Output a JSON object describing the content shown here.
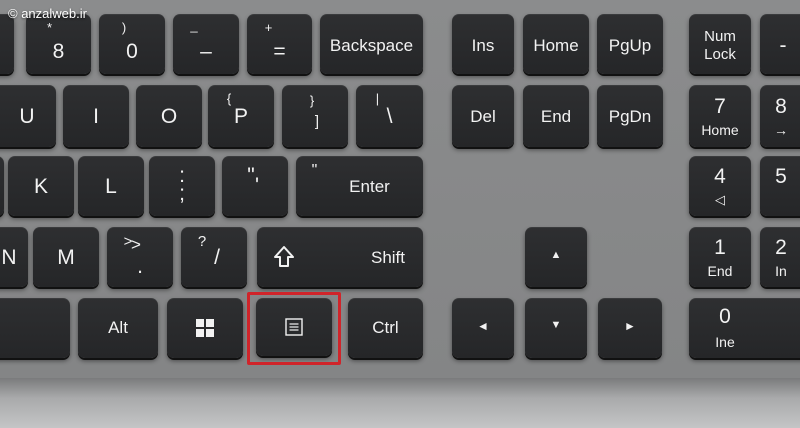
{
  "watermark": "© anzalweb.ir",
  "keys": {
    "eight": {
      "top": "*",
      "main": "8"
    },
    "zero": {
      "top": ")",
      "main": "0"
    },
    "minus": {
      "top": "_",
      "main": "–"
    },
    "equals": {
      "top": "+",
      "main": "="
    },
    "backspace": "Backspace",
    "ins": "Ins",
    "home": "Home",
    "pgup": "PgUp",
    "numlock": {
      "line1": "Num",
      "line2": "Lock"
    },
    "num_minus": "-",
    "u": "U",
    "i": "I",
    "o": "O",
    "p": "P",
    "lbracket": {
      "top": "{",
      "main": "["
    },
    "rbracket": {
      "top": "}",
      "main": "]"
    },
    "backslash": {
      "top": "|",
      "main": "\\"
    },
    "del": "Del",
    "end": "End",
    "pgdn": "PgDn",
    "num7": {
      "main": "7",
      "sub": "Home"
    },
    "num8": {
      "main": "8",
      "sub": "→"
    },
    "k": "K",
    "l": "L",
    "semicolon": {
      "top": ":",
      "main": ";"
    },
    "quote": {
      "top": "\"",
      "main": "'"
    },
    "enter": {
      "top": "\"",
      "main": "Enter"
    },
    "num4": {
      "main": "4",
      "sub": "◁"
    },
    "num5": "5",
    "n": "N",
    "m": "M",
    "period": {
      "top": ">",
      "main": "."
    },
    "slash": {
      "top": "?",
      "main": "/"
    },
    "shift": "Shift",
    "up": "▲",
    "num1": {
      "main": "1",
      "sub": "End"
    },
    "num2": {
      "main": "2",
      "sub": "In"
    },
    "alt": "Alt",
    "ctrl": "Ctrl",
    "left": "◄",
    "down": "▼",
    "right": "►",
    "num0": {
      "main": "0",
      "sub": "Ine"
    }
  },
  "colors": {
    "key": "#2b2c2e",
    "deck": "#868788",
    "highlight": "#d0242a"
  }
}
